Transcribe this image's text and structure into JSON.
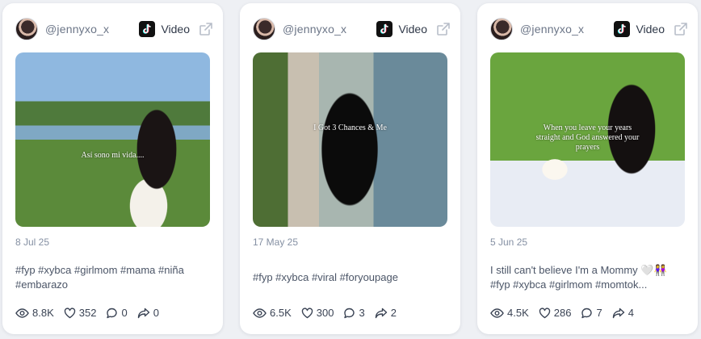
{
  "cards": [
    {
      "username": "@jennyxo_x",
      "platform": "Video",
      "overlay": "Así sono mi vida....",
      "date": "8 Jul 25",
      "caption_lines": [
        "#fyp #xybca #girlmom #mama #niña",
        "#embarazo"
      ],
      "views": "8.8K",
      "likes": "352",
      "comments": "0",
      "shares": "0"
    },
    {
      "username": "@jennyxo_x",
      "platform": "Video",
      "overlay": "I Got 3 Chances & Me",
      "date": "17 May 25",
      "caption_lines": [
        "#fyp #xybca #viral #foryoupage"
      ],
      "views": "6.5K",
      "likes": "300",
      "comments": "3",
      "shares": "2"
    },
    {
      "username": "@jennyxo_x",
      "platform": "Video",
      "overlay_lines": [
        "When you leave your years",
        "straight and God answered your",
        "prayers"
      ],
      "date": "5 Jun 25",
      "caption_lines": [
        "I still can't believe I'm a Mommy 🤍👭",
        "#fyp #xybca #girlmom #momtok..."
      ],
      "views": "4.5K",
      "likes": "286",
      "comments": "7",
      "shares": "4"
    }
  ],
  "icons": {
    "platform": "tiktok-icon",
    "external": "external-link-icon",
    "views": "eye-icon",
    "likes": "heart-icon",
    "comments": "comment-icon",
    "shares": "share-icon"
  }
}
